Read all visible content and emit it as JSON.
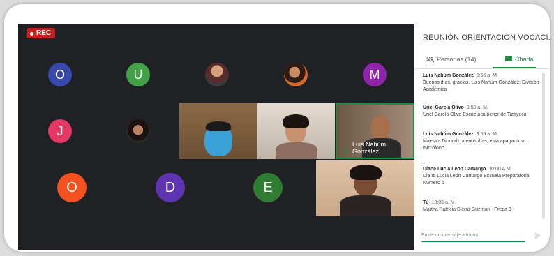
{
  "recording": {
    "label": "REC"
  },
  "participants_grid": {
    "row1": [
      {
        "initial": "O",
        "color": "#3949ab"
      },
      {
        "initial": "U",
        "color": "#43a047"
      },
      {
        "initial": "M",
        "color": "#8e24aa"
      }
    ],
    "row2": [
      {
        "initial": "J",
        "color": "#e53965"
      }
    ],
    "row3": [
      {
        "initial": "O",
        "color": "#f4511e"
      },
      {
        "initial": "D",
        "color": "#5e35b1"
      },
      {
        "initial": "E",
        "color": "#2e7d32"
      }
    ],
    "featured_name": "Luis Nahúm González"
  },
  "panel": {
    "title": "REUNIÓN ORIENTACIÓN VOCACI...",
    "tabs": {
      "people": "Personas (14)",
      "chat": "Charla"
    },
    "composer_placeholder": "Envíe un mensaje a todos"
  },
  "messages": [
    {
      "sender": "Luis Nahúm González",
      "time": "9:56 a. M.",
      "text": "Buenos días, gracias. Luis Nahúm González; División Académica"
    },
    {
      "sender": "Uriel García Olivo",
      "time": "9:58 a. M.",
      "text": "Uriel García Olivo Escuela superior de Tizayuca"
    },
    {
      "sender": "Luis Nahúm González",
      "time": "9:59 a. M.",
      "text": "Maestra Dinorah buenos días, está apagado su micrófono"
    },
    {
      "sender": "Diana Lucia Leon Camargo",
      "time": "10:00 A.M",
      "text": "Diana Lucia León Camargo Escuela Preparatoria Número 6"
    },
    {
      "sender": "Tú",
      "time": "10:03 a. M.",
      "text": "Martha Patricia Sierra Guzmán - Prepa 3"
    }
  ],
  "colors": {
    "accent": "#1e8e3e",
    "video_bg": "#202124",
    "rec": "#c5221f"
  }
}
